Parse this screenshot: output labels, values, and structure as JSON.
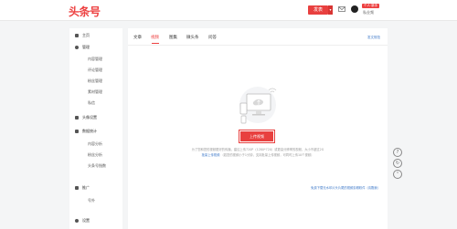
{
  "header": {
    "logo": "头条号",
    "publish_label": "发表",
    "cert_tag": "个人·新手",
    "username": "私业频"
  },
  "sidebar": {
    "items": [
      {
        "label": "主页",
        "icon": "home-icon"
      },
      {
        "label": "管理",
        "icon": "gear-icon"
      },
      {
        "label": "内容管理"
      },
      {
        "label": "评论管理"
      },
      {
        "label": "粉丝管理"
      },
      {
        "label": "素材管理"
      },
      {
        "label": "私信"
      },
      {
        "label": "头像设置",
        "icon": "user-icon"
      },
      {
        "label": "数据统计",
        "icon": "chart-icon"
      },
      {
        "label": "内容分析"
      },
      {
        "label": "粉丝分析"
      },
      {
        "label": "头条号指数"
      },
      {
        "label": "推广",
        "icon": "megaphone-icon"
      },
      {
        "label": "号外"
      },
      {
        "label": "设置",
        "icon": "settings-icon"
      }
    ]
  },
  "main": {
    "tabs": [
      {
        "label": "文章"
      },
      {
        "label": "视频"
      },
      {
        "label": "图集"
      },
      {
        "label": "微头条"
      },
      {
        "label": "问答"
      }
    ],
    "active_tab": "视频",
    "right_link": "发文规范",
    "upload_label": "上传视频",
    "hint_line1": "为了您和您的视频更好的传播，建议上传720P（1280*720）或更高分辨率的视频，大小不超过2G",
    "hint_line2": "（若您的视频小于1分钟，支持批量上传视频，可同时上传10个视频）",
    "hint_link": "批量上传视频",
    "footer_link": "免费下载无水印片头片尾的视频剪辑软件（请戳我）"
  },
  "colors": {
    "accent": "#e8403f",
    "link": "#3b77c8"
  }
}
